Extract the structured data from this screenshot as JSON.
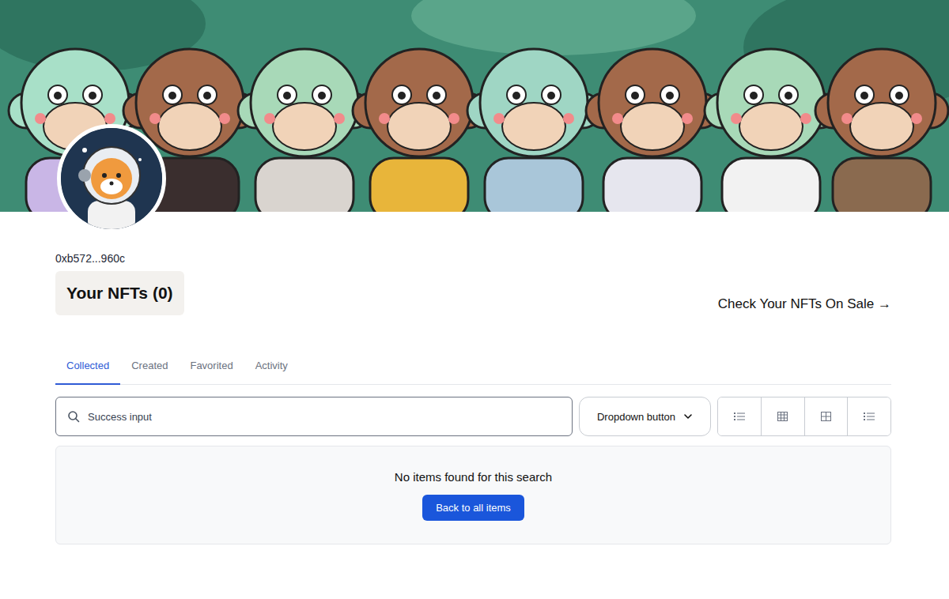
{
  "profile": {
    "address": "0xb572...960c"
  },
  "heading": {
    "title": "Your NFTs (0)",
    "link": "Check Your NFTs On Sale →"
  },
  "tabs": [
    {
      "label": "Collected",
      "selected": true
    },
    {
      "label": "Created",
      "selected": false
    },
    {
      "label": "Favorited",
      "selected": false
    },
    {
      "label": "Activity",
      "selected": false
    }
  ],
  "search": {
    "value": "Success input"
  },
  "dropdown": {
    "label": "Dropdown button"
  },
  "empty": {
    "message": "No items found for this search",
    "button": "Back to all items"
  }
}
